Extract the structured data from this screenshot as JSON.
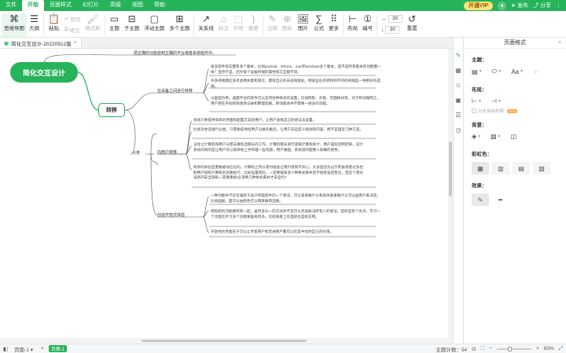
{
  "menubar": {
    "file": "文件",
    "items": [
      "开始",
      "页面样式",
      "幻灯片",
      "高级",
      "视图",
      "帮助"
    ],
    "vip": "开通VIP",
    "publish": "发布",
    "share": "分享"
  },
  "ribbon": {
    "mindmap_mode": "思维导图",
    "outline": "大纲",
    "paste": "粘贴",
    "cut": "剪切",
    "copy": "拷贝",
    "format_painter": "格式刷",
    "topic": "主题",
    "subtopic": "子主题",
    "floating_topic": "浮动主题",
    "multi_topic": "多个主题",
    "relation": "关系线",
    "label": "标注",
    "outline_frame": "外框",
    "summary": "概要",
    "note": "注释",
    "tag": "图标",
    "image": "图片",
    "formula": "公式",
    "more": "更多",
    "layout": "布局",
    "number": "编号",
    "spacing_h": "30",
    "spacing_v": "30",
    "reset": "重置"
  },
  "doc_tab": {
    "title": "简化交互设计-20220912版"
  },
  "mindmap": {
    "root": "简化交互设计",
    "main": "转移",
    "top_note": "把正确的功能放到正确的平台或者系统组件中。",
    "branches": [
      {
        "label": "在设备之间进行转移",
        "leaves": [
          "很多软件现在都有多个版本，比如android、iPhone、mac和windows多个版本，是不是所有版本的功能都一样？显然不是，因为每个设备终端的属性和交互都不同。",
          "许多终端都应该考虑用体量和频次，都有自己的去处和能处。把某些任务转移到不同的终端是一种更好的选择。",
          "以画图为例，桌面平台的软件可以支持各种样式的设置，比如阴影、外框、页面样式等。对于移动端而言，用户更在乎如何快速地记录和整理思路。移动版本并不需要一样多的功能。"
        ]
      },
      {
        "label": "分类",
        "leaves": []
      },
      {
        "label": "向用户转移",
        "leaves": [
          "系统只要提供简单的界面和配置方案给用户，让用户发挥自己的想法去设置。",
          "比如对会话进行分类，只需要提供给用户分类的概念，让用户去自定义规则和内容，而不是固定几种方案。",
          "记住让计算机和用户分担去做各自擅长的工作。计算机擅长进行逻辑计算和统计，用户喜欢控制结果。设计系统的目的是让用户可以简单地上手和理一些问题，用户做图，系统操作图像入屏幕的感觉。",
          "简单的体验是需要被动信任的。计算机之所以有时候会让用户感到不开心，大多是因为过于死板或者过多控制用户按照计算机的思路执行。比如设置密码，一定要按照多少种格式来并且不接受设定变化，但这个密码设各的安全隐私一定要重视!必须要几种格式来并才安全吗?"
        ]
      },
      {
        "label": "创造开放式体验",
        "leaves": [
          "一种功能并不仅仅满足于设计师脑袋中的一个想法，可以拿来做什么和具体拿来做什么可以由用户来决定。比如画报，面可以由颜色可以用来做筛选数。",
          "把指标的功能模块到一起，虽然多分一的方式并不定可以完美解决所有人的想法。但听是有个优点，学习一个功能比学习多个功能要容易得多。比如系屋上的温控也是标志物。",
          "开放性的界面在于可以让专家用户和普通用户都可以在其中找到自己的价值。"
        ]
      }
    ]
  },
  "panel": {
    "title": "页面格式",
    "theme_label": "主题：",
    "layout_label": "布局：",
    "branch_free": "分支自由布局",
    "new_badge": "New",
    "background_label": "背景：",
    "rainbow_label": "彩虹色：",
    "effect_label": "效果："
  },
  "status": {
    "page": "页面-1",
    "add": "+",
    "page_tab": "页面-1",
    "topic_count": "主题计数：54",
    "zoom": "83%"
  },
  "colors": {
    "brand": "#26b35a",
    "vip": "#ffe27a"
  }
}
